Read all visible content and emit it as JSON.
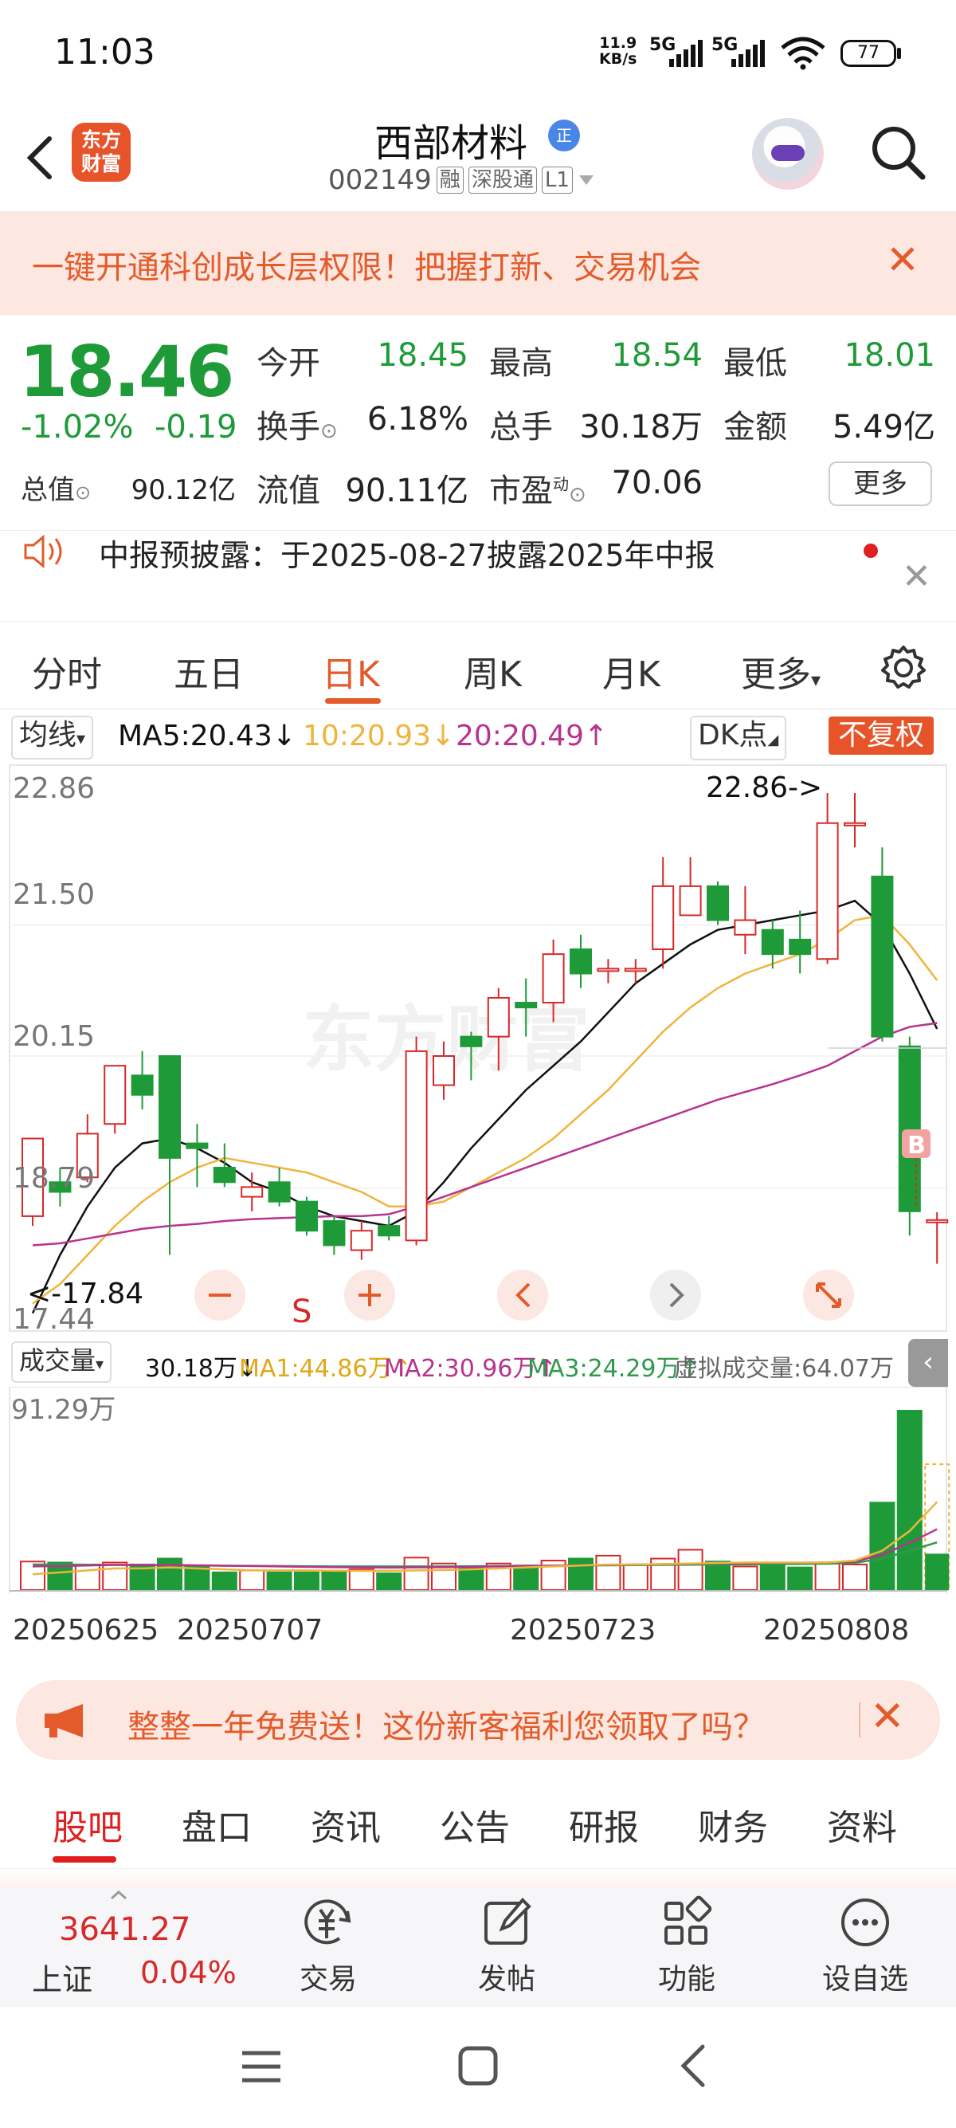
{
  "status_bar": {
    "time": "11:03",
    "net_speed": "11.9",
    "net_unit": "KB/s",
    "sig1": "5G",
    "sig2": "5G",
    "battery": "77"
  },
  "header": {
    "logo_line1": "东方",
    "logo_line2": "财富",
    "stock_name": "西部材料",
    "badge": "正",
    "code": "002149",
    "tag_rong": "融",
    "tag_sgt": "深股通",
    "tag_l1": "L1"
  },
  "promo": {
    "text": "一键开通科创成长层权限！把握打新、交易机会",
    "close": "✕"
  },
  "quote": {
    "price": "18.46",
    "change_pct": "-1.02%",
    "change_amt": "-0.19",
    "open_label": "今开",
    "open": "18.45",
    "high_label": "最高",
    "high": "18.54",
    "low_label": "最低",
    "low": "18.01",
    "turnover_label": "换手",
    "turnover": "6.18%",
    "volume_label": "总手",
    "volume": "30.18万",
    "amount_label": "金额",
    "amount": "5.49亿",
    "mktcap_label": "总值",
    "mktcap": "90.12亿",
    "float_label": "流值",
    "float": "90.11亿",
    "pe_label": "市盈",
    "pe_sup": "动",
    "pe": "70.06",
    "more_btn": "更多"
  },
  "notice": {
    "text": "中报预披露：于2025-08-27披露2025年中报",
    "close": "✕"
  },
  "kline_tabs": [
    "分时",
    "五日",
    "日K",
    "周K",
    "月K",
    "更多"
  ],
  "ma_line": {
    "selector": "均线",
    "ma5": "MA5:20.43",
    "ma10": "10:20.93",
    "ma20": "20:20.49",
    "dk": "DK点",
    "fuquan": "不复权"
  },
  "chart_labels": {
    "y_top": "22.86",
    "y2": "21.50",
    "y3": "20.15",
    "y4": "18.79",
    "y_bot": "17.44",
    "max_marker": "22.86->",
    "min_marker": "<-17.84",
    "s_marker": "S",
    "b_marker": "B",
    "watermark": "东方财富"
  },
  "volume_header": {
    "selector": "成交量",
    "vol": "30.18万",
    "ma1": "MA1:44.86万",
    "ma2": "MA2:30.96万",
    "ma3": "MA3:24.29万",
    "virtual": "虚拟成交量:64.07万",
    "max": "91.29万"
  },
  "dates": [
    "20250625",
    "20250707",
    "20250723",
    "20250808"
  ],
  "promo2": {
    "text": "整整一年免费送！这份新客福利您领取了吗？",
    "close": "✕"
  },
  "bottom_tabs": [
    "股吧",
    "盘口",
    "资讯",
    "公告",
    "研报",
    "财务",
    "资料"
  ],
  "bottom_bar": {
    "index_value": "3641.27",
    "index_name": "上证",
    "index_change": "0.04%",
    "trade": "交易",
    "post": "发帖",
    "func": "功能",
    "watch": "设自选"
  },
  "colors": {
    "up": "#d82828",
    "down": "#1e9b38",
    "accent": "#e45b2b",
    "ma5": "#111111",
    "ma10": "#f0b43c",
    "ma20": "#b8338f"
  },
  "chart_data": {
    "type": "candlestick",
    "y_range": [
      17.44,
      22.86
    ],
    "candles": [
      {
        "o": 18.5,
        "c": 19.3,
        "h": 19.3,
        "l": 18.4
      },
      {
        "o": 18.85,
        "c": 18.75,
        "h": 19.0,
        "l": 18.6
      },
      {
        "o": 18.9,
        "c": 19.35,
        "h": 19.55,
        "l": 18.85
      },
      {
        "o": 19.45,
        "c": 20.05,
        "h": 20.05,
        "l": 19.35
      },
      {
        "o": 19.95,
        "c": 19.75,
        "h": 20.2,
        "l": 19.6
      },
      {
        "o": 20.15,
        "c": 19.1,
        "h": 20.15,
        "l": 18.1
      },
      {
        "o": 19.25,
        "c": 19.2,
        "h": 19.45,
        "l": 18.8
      },
      {
        "o": 19.0,
        "c": 18.85,
        "h": 19.25,
        "l": 18.8
      },
      {
        "o": 18.7,
        "c": 18.8,
        "h": 18.95,
        "l": 18.55
      },
      {
        "o": 18.85,
        "c": 18.65,
        "h": 19.0,
        "l": 18.6
      },
      {
        "o": 18.65,
        "c": 18.35,
        "h": 18.7,
        "l": 18.3
      },
      {
        "o": 18.45,
        "c": 18.2,
        "h": 18.5,
        "l": 18.1
      },
      {
        "o": 18.15,
        "c": 18.35,
        "h": 18.45,
        "l": 18.05
      },
      {
        "o": 18.4,
        "c": 18.3,
        "h": 18.5,
        "l": 18.25
      },
      {
        "o": 18.25,
        "c": 20.2,
        "h": 20.35,
        "l": 18.2
      },
      {
        "o": 19.85,
        "c": 20.15,
        "h": 20.3,
        "l": 19.7
      },
      {
        "o": 20.35,
        "c": 20.25,
        "h": 20.4,
        "l": 19.9
      },
      {
        "o": 20.35,
        "c": 20.75,
        "h": 20.85,
        "l": 20.0
      },
      {
        "o": 20.7,
        "c": 20.65,
        "h": 20.95,
        "l": 20.35
      },
      {
        "o": 20.7,
        "c": 21.2,
        "h": 21.35,
        "l": 20.5
      },
      {
        "o": 21.25,
        "c": 21.0,
        "h": 21.4,
        "l": 20.85
      },
      {
        "o": 21.05,
        "c": 21.05,
        "h": 21.15,
        "l": 20.9
      },
      {
        "o": 21.05,
        "c": 21.05,
        "h": 21.15,
        "l": 20.9
      },
      {
        "o": 21.25,
        "c": 21.9,
        "h": 22.2,
        "l": 21.05
      },
      {
        "o": 21.6,
        "c": 21.9,
        "h": 22.2,
        "l": 21.6
      },
      {
        "o": 21.9,
        "c": 21.55,
        "h": 21.95,
        "l": 21.5
      },
      {
        "o": 21.4,
        "c": 21.55,
        "h": 21.9,
        "l": 21.2
      },
      {
        "o": 21.45,
        "c": 21.2,
        "h": 21.55,
        "l": 21.05
      },
      {
        "o": 21.35,
        "c": 21.2,
        "h": 21.65,
        "l": 21.0
      },
      {
        "o": 21.15,
        "c": 22.55,
        "h": 22.86,
        "l": 21.1
      },
      {
        "o": 22.55,
        "c": 22.55,
        "h": 22.86,
        "l": 22.3
      },
      {
        "o": 22.0,
        "c": 20.35,
        "h": 22.3,
        "l": 20.3
      },
      {
        "o": 20.25,
        "c": 18.55,
        "h": 20.35,
        "l": 18.3
      },
      {
        "o": 18.45,
        "c": 18.46,
        "h": 18.54,
        "l": 18.01
      }
    ],
    "ma5": [
      17.5,
      18.1,
      18.6,
      19.0,
      19.25,
      19.3,
      19.2,
      19.05,
      18.85,
      18.75,
      18.6,
      18.5,
      18.45,
      18.4,
      18.55,
      18.85,
      19.2,
      19.5,
      19.8,
      20.05,
      20.3,
      20.6,
      20.9,
      21.1,
      21.3,
      21.45,
      21.5,
      21.55,
      21.6,
      21.65,
      21.75,
      21.5,
      21.0,
      20.43
    ],
    "ma10": [
      17.6,
      17.8,
      18.1,
      18.4,
      18.65,
      18.85,
      19.0,
      19.1,
      19.05,
      19.0,
      18.95,
      18.85,
      18.75,
      18.6,
      18.6,
      18.65,
      18.8,
      18.95,
      19.1,
      19.3,
      19.55,
      19.8,
      20.1,
      20.4,
      20.65,
      20.85,
      21.0,
      21.1,
      21.2,
      21.35,
      21.55,
      21.6,
      21.3,
      20.93
    ],
    "ma20": [
      18.2,
      18.22,
      18.27,
      18.32,
      18.37,
      18.4,
      18.42,
      18.45,
      18.47,
      18.48,
      18.49,
      18.5,
      18.5,
      18.52,
      18.6,
      18.7,
      18.8,
      18.9,
      19.0,
      19.1,
      19.2,
      19.3,
      19.4,
      19.5,
      19.6,
      19.7,
      19.78,
      19.86,
      19.95,
      20.05,
      20.2,
      20.35,
      20.45,
      20.49
    ],
    "volumes": [
      14.5,
      14.0,
      13.0,
      14.0,
      13.0,
      16.0,
      12.0,
      9.0,
      10.0,
      9.0,
      9.0,
      9.5,
      10.5,
      8.5,
      16.5,
      13.5,
      12.0,
      13.5,
      12.5,
      15.0,
      16.0,
      17.5,
      13.0,
      16.0,
      20.5,
      14.5,
      12.0,
      14.0,
      11.5,
      14.0,
      13.0,
      44.5,
      91.29,
      64.07
    ],
    "vol_ma1": [
      8,
      9,
      10,
      11,
      11,
      11.5,
      11,
      10.5,
      10,
      10,
      10,
      9.8,
      9.8,
      9.8,
      10,
      10.2,
      10.5,
      11,
      11.5,
      12,
      12.5,
      13,
      13,
      13.2,
      13.5,
      13.8,
      14,
      14,
      14,
      14,
      15,
      20,
      30,
      44.86
    ],
    "vol_ma2": [
      12,
      12.2,
      12.5,
      12.8,
      12.8,
      12.8,
      12.6,
      12.4,
      12.2,
      12,
      11.8,
      11.6,
      11.5,
      11.4,
      11.5,
      11.6,
      11.8,
      12,
      12.2,
      12.4,
      12.6,
      12.8,
      13,
      13.2,
      13.4,
      13.6,
      13.7,
      13.8,
      13.9,
      14,
      14.5,
      18,
      24,
      30.96
    ],
    "vol_ma3": [
      13,
      13,
      12.9,
      12.8,
      12.7,
      12.6,
      12.5,
      12.4,
      12.3,
      12.2,
      12.1,
      12,
      12,
      12,
      12,
      12,
      12.1,
      12.2,
      12.3,
      12.4,
      12.5,
      12.6,
      12.7,
      12.8,
      12.9,
      13,
      13.1,
      13.2,
      13.3,
      13.4,
      13.8,
      16,
      20,
      24.29
    ]
  }
}
